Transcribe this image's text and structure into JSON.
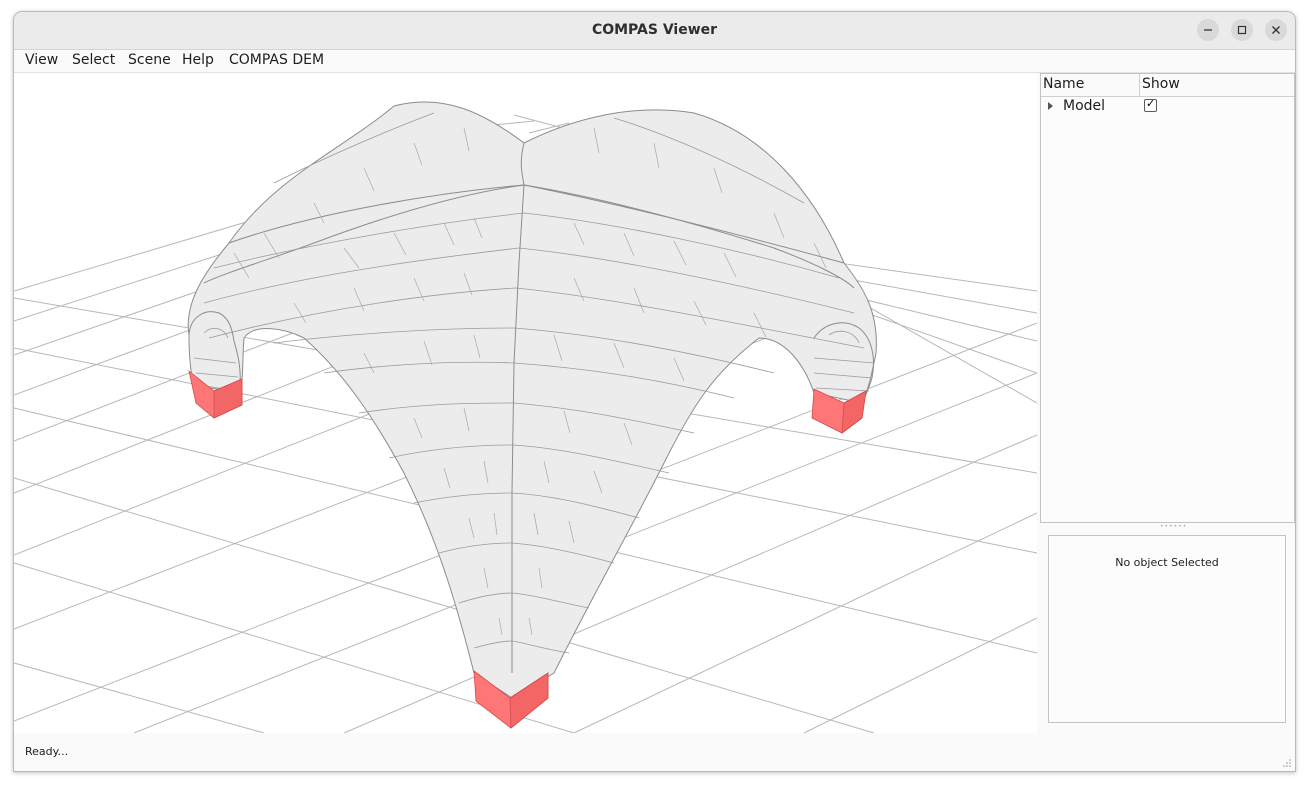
{
  "window": {
    "title": "COMPAS Viewer"
  },
  "menu": {
    "items": [
      "View",
      "Select",
      "Scene",
      "Help",
      "COMPAS DEM"
    ]
  },
  "scene_tree": {
    "columns": [
      "Name",
      "Show"
    ],
    "rows": [
      {
        "name": "Model",
        "show": true,
        "show_glyph": "✓"
      }
    ]
  },
  "info_panel": {
    "text": "No object Selected"
  },
  "status": {
    "text": "Ready..."
  },
  "viewport": {
    "model": "masonry cross vault",
    "block_color": "#ececec",
    "edge_color": "#8c8c8c",
    "support_color": "#ff6b6b",
    "grid_color": "#b7b7b7"
  },
  "icons": {
    "minimize": "minimize-icon",
    "maximize": "maximize-icon",
    "close": "close-icon",
    "expand": "expand-arrow-icon"
  }
}
